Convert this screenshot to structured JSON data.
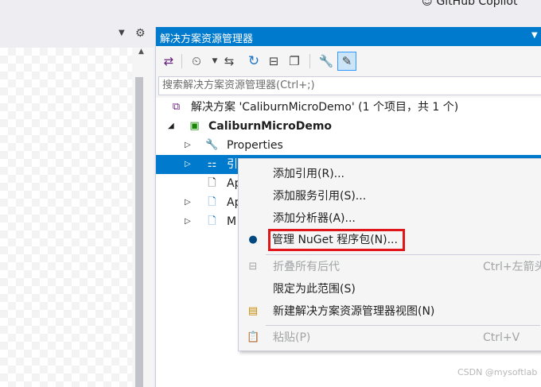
{
  "top": {
    "copilot": "GitHub Copilot"
  },
  "solution_explorer": {
    "title": "解决方案资源管理器",
    "search_placeholder": "搜索解决方案资源管理器(Ctrl+;)",
    "tree": {
      "solution": "解决方案 'CaliburnMicroDemo' (1 个项目，共 1 个)",
      "project": "CaliburnMicroDemo",
      "properties": "Properties",
      "references": "引",
      "item_ap1": "Ap",
      "item_ap2": "Ap",
      "item_m": "M"
    }
  },
  "context_menu": {
    "add_reference": "添加引用(R)...",
    "add_service_reference": "添加服务引用(S)...",
    "add_analyzer": "添加分析器(A)...",
    "manage_nuget": "管理 NuGet 程序包(N)...",
    "collapse_all": "折叠所有后代",
    "collapse_all_shortcut": "Ctrl+左箭头",
    "scope_to_this": "限定为此范围(S)",
    "new_view": "新建解决方案资源管理器视图(N)",
    "paste": "粘贴(P)",
    "paste_shortcut": "Ctrl+V"
  },
  "watermark": "CSDN @mysoftlab",
  "colors": {
    "accent": "#007acc",
    "highlight_border": "#e0161b"
  }
}
